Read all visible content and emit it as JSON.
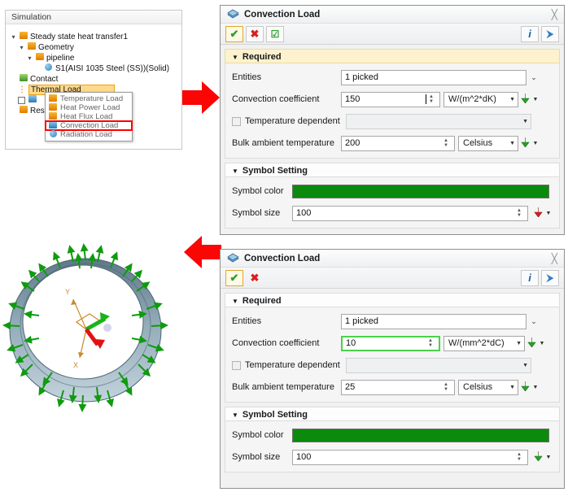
{
  "sim_panel": {
    "title": "Simulation",
    "tree": [
      {
        "label": "Steady state heat transfer1",
        "icon": "heat-transfer-icon",
        "indent": 0,
        "expander": "expanded",
        "selected": false,
        "checkbox": false
      },
      {
        "label": "Geometry",
        "icon": "geometry-folder-icon",
        "indent": 1,
        "expander": "expanded",
        "selected": false,
        "checkbox": false
      },
      {
        "label": "pipeline",
        "icon": "part-folder-icon",
        "indent": 2,
        "expander": "expanded",
        "selected": false,
        "checkbox": false
      },
      {
        "label": "S1(AISI 1035 Steel (SS))(Solid)",
        "icon": "solid-body-icon",
        "indent": 4,
        "expander": "none",
        "selected": false,
        "checkbox": false
      },
      {
        "label": "Contact",
        "icon": "contact-icon",
        "indent": 1,
        "expander": "none",
        "selected": false,
        "checkbox": false
      },
      {
        "label": "Thermal Load",
        "icon": "thermal-load-icon",
        "indent": 1,
        "expander": "none",
        "selected": true,
        "checkbox": false
      },
      {
        "label": "",
        "icon": "constraint-icon",
        "indent": 1,
        "expander": "none",
        "selected": false,
        "checkbox": true
      },
      {
        "label": "Res",
        "icon": "result-icon",
        "indent": 1,
        "expander": "none",
        "selected": false,
        "checkbox": false
      }
    ],
    "context_menu": {
      "items": [
        {
          "label": "Temperature Load",
          "icon": "temperature-load-icon",
          "highlighted": false
        },
        {
          "label": "Heat Power Load",
          "icon": "heat-power-load-icon",
          "highlighted": false
        },
        {
          "label": "Heat Flux Load",
          "icon": "heat-flux-load-icon",
          "highlighted": false
        },
        {
          "label": "Convection Load",
          "icon": "convection-load-icon",
          "highlighted": true
        },
        {
          "label": "Radiation Load",
          "icon": "radiation-load-icon",
          "highlighted": false
        }
      ],
      "highlight_color": "#ff0000"
    }
  },
  "viewport": {
    "name": "pipe-ring-3d-view",
    "triad": {
      "x_axis_label": "X",
      "y_axis_label": "Y"
    },
    "symbol_color": "#14a014",
    "body_color": "#7d98a8"
  },
  "dialog_top": {
    "title": "Convection Load",
    "icon": "convection-load-icon",
    "close_label": "╳",
    "toolbar": [
      {
        "name": "ok-button",
        "glyph": "✔",
        "color": "#2aa02a",
        "selected": true
      },
      {
        "name": "cancel-button",
        "glyph": "✖",
        "color": "#d82020",
        "selected": false
      },
      {
        "name": "apply-button",
        "glyph": "☑",
        "color": "#2aa02a",
        "selected": false
      }
    ],
    "right_toolbar": [
      {
        "name": "info-button",
        "glyph": "i"
      },
      {
        "name": "help-button",
        "glyph": "⮞"
      }
    ],
    "required_group": {
      "header": "Required",
      "entities": {
        "label": "Entities",
        "value": "1 picked",
        "expand_icon": "double-chevron-down-icon"
      },
      "convection_coefficient": {
        "label": "Convection coefficient",
        "value": "150",
        "unit": "W/(m^2*dK)",
        "focused": true,
        "measure_icon": "measure-green-icon"
      },
      "temperature_dependent": {
        "label": "Temperature dependent",
        "checked": false,
        "value": ""
      },
      "bulk_ambient_temperature": {
        "label": "Bulk ambient temperature",
        "value": "200",
        "unit": "Celsius",
        "measure_icon": "measure-green-icon"
      }
    },
    "symbol_group": {
      "header": "Symbol Setting",
      "symbol_color": {
        "label": "Symbol color",
        "value": "#0b8a0b"
      },
      "symbol_size": {
        "label": "Symbol size",
        "value": "100",
        "measure_icon": "measure-red-icon"
      }
    }
  },
  "dialog_bottom": {
    "title": "Convection Load",
    "icon": "convection-load-icon",
    "close_label": "╳",
    "toolbar": [
      {
        "name": "ok-button",
        "glyph": "✔",
        "color": "#2aa02a",
        "selected": true
      },
      {
        "name": "cancel-button",
        "glyph": "✖",
        "color": "#d82020",
        "selected": false
      }
    ],
    "right_toolbar": [
      {
        "name": "info-button",
        "glyph": "i"
      },
      {
        "name": "help-button",
        "glyph": "⮞"
      }
    ],
    "required_group": {
      "header": "Required",
      "entities": {
        "label": "Entities",
        "value": "1 picked",
        "expand_icon": "double-chevron-down-icon"
      },
      "convection_coefficient": {
        "label": "Convection coefficient",
        "value": "10",
        "unit": "W/(mm^2*dC)",
        "focused": false,
        "measure_icon": "measure-green-icon"
      },
      "temperature_dependent": {
        "label": "Temperature dependent",
        "checked": false,
        "value": ""
      },
      "bulk_ambient_temperature": {
        "label": "Bulk ambient temperature",
        "value": "25",
        "unit": "Celsius",
        "measure_icon": "measure-green-icon"
      }
    },
    "symbol_group": {
      "header": "Symbol Setting",
      "symbol_color": {
        "label": "Symbol color",
        "value": "#0b8a0b"
      },
      "symbol_size": {
        "label": "Symbol size",
        "value": "100",
        "measure_icon": "measure-green-icon"
      }
    }
  },
  "annotations": {
    "arrow_color": "#fb0505",
    "arrow_top_name": "red-arrow-to-top-dialog",
    "arrow_bottom_name": "red-arrow-to-bottom-dialog"
  }
}
